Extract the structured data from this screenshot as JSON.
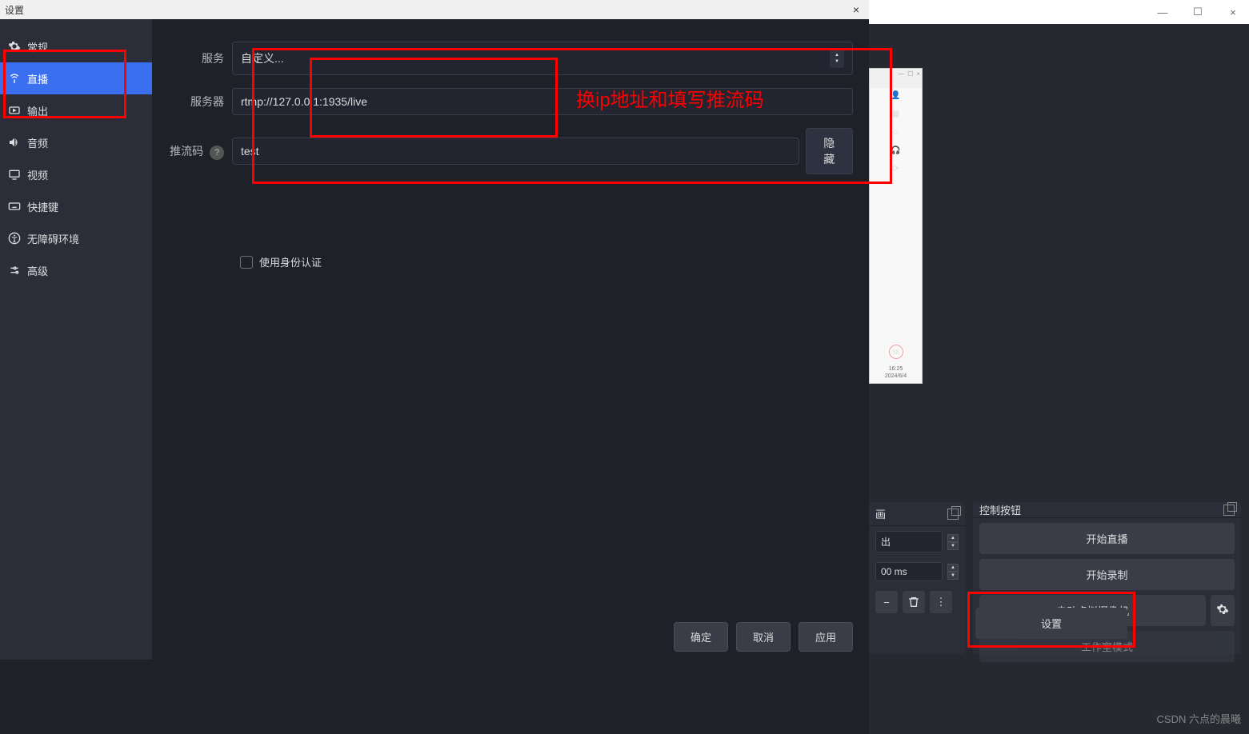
{
  "dialog": {
    "title": "设置",
    "close": "×"
  },
  "sidebar": {
    "items": [
      {
        "label": "常规"
      },
      {
        "label": "直播"
      },
      {
        "label": "输出"
      },
      {
        "label": "音频"
      },
      {
        "label": "视频"
      },
      {
        "label": "快捷键"
      },
      {
        "label": "无障碍环境"
      },
      {
        "label": "高级"
      }
    ]
  },
  "form": {
    "service_label": "服务",
    "service_value": "自定义...",
    "server_label": "服务器",
    "server_value": "rtmp://127.0.0.1:1935/live",
    "streamkey_label": "推流码",
    "streamkey_value": "test",
    "hide_btn": "隐藏",
    "help": "?",
    "use_auth_label": "使用身份认证"
  },
  "annotation": {
    "text": "换ip地址和填写推流码"
  },
  "footer": {
    "ok": "确定",
    "cancel": "取消",
    "apply": "应用"
  },
  "bg_window": {
    "minimize": "—",
    "maximize": "☐",
    "close": "×",
    "preview_badge": "66",
    "preview_time1": "16:25",
    "preview_time2": "2024/6/4"
  },
  "panels": {
    "left_title": "画",
    "left_row1": "出",
    "left_row2": "00 ms",
    "right_title": "控制按钮",
    "btn_start_stream": "开始直播",
    "btn_start_record": "开始录制",
    "btn_virtual_cam": "启动虚拟摄像机",
    "btn_studio_mode": "工作室模式",
    "btn_settings": "设置"
  },
  "watermark": "CSDN 六点的晨曦"
}
